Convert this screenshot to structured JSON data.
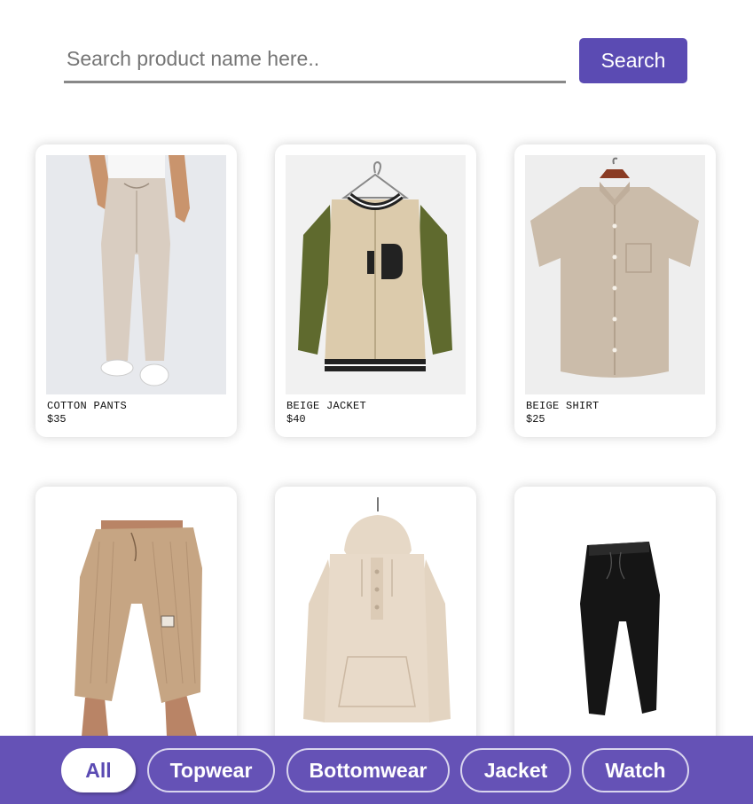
{
  "search": {
    "placeholder": "Search product name here..",
    "value": "",
    "button_label": "Search"
  },
  "products": [
    {
      "name": "COTTON PANTS",
      "price": "$35",
      "image_icon": "cotton-pants-image"
    },
    {
      "name": "BEIGE JACKET",
      "price": "$40",
      "image_icon": "beige-jacket-image"
    },
    {
      "name": "BEIGE SHIRT",
      "price": "$25",
      "image_icon": "beige-shirt-image"
    },
    {
      "name": "",
      "price": "",
      "image_icon": "corduroy-shorts-image"
    },
    {
      "name": "",
      "price": "",
      "image_icon": "beige-hoodie-image"
    },
    {
      "name": "",
      "price": "",
      "image_icon": "black-joggers-image"
    }
  ],
  "filters": {
    "items": [
      {
        "label": "All",
        "active": true
      },
      {
        "label": "Topwear",
        "active": false
      },
      {
        "label": "Bottomwear",
        "active": false
      },
      {
        "label": "Jacket",
        "active": false
      },
      {
        "label": "Watch",
        "active": false
      }
    ]
  },
  "colors": {
    "accent": "#5b4bb3",
    "filter_bar": "#6552b6"
  }
}
